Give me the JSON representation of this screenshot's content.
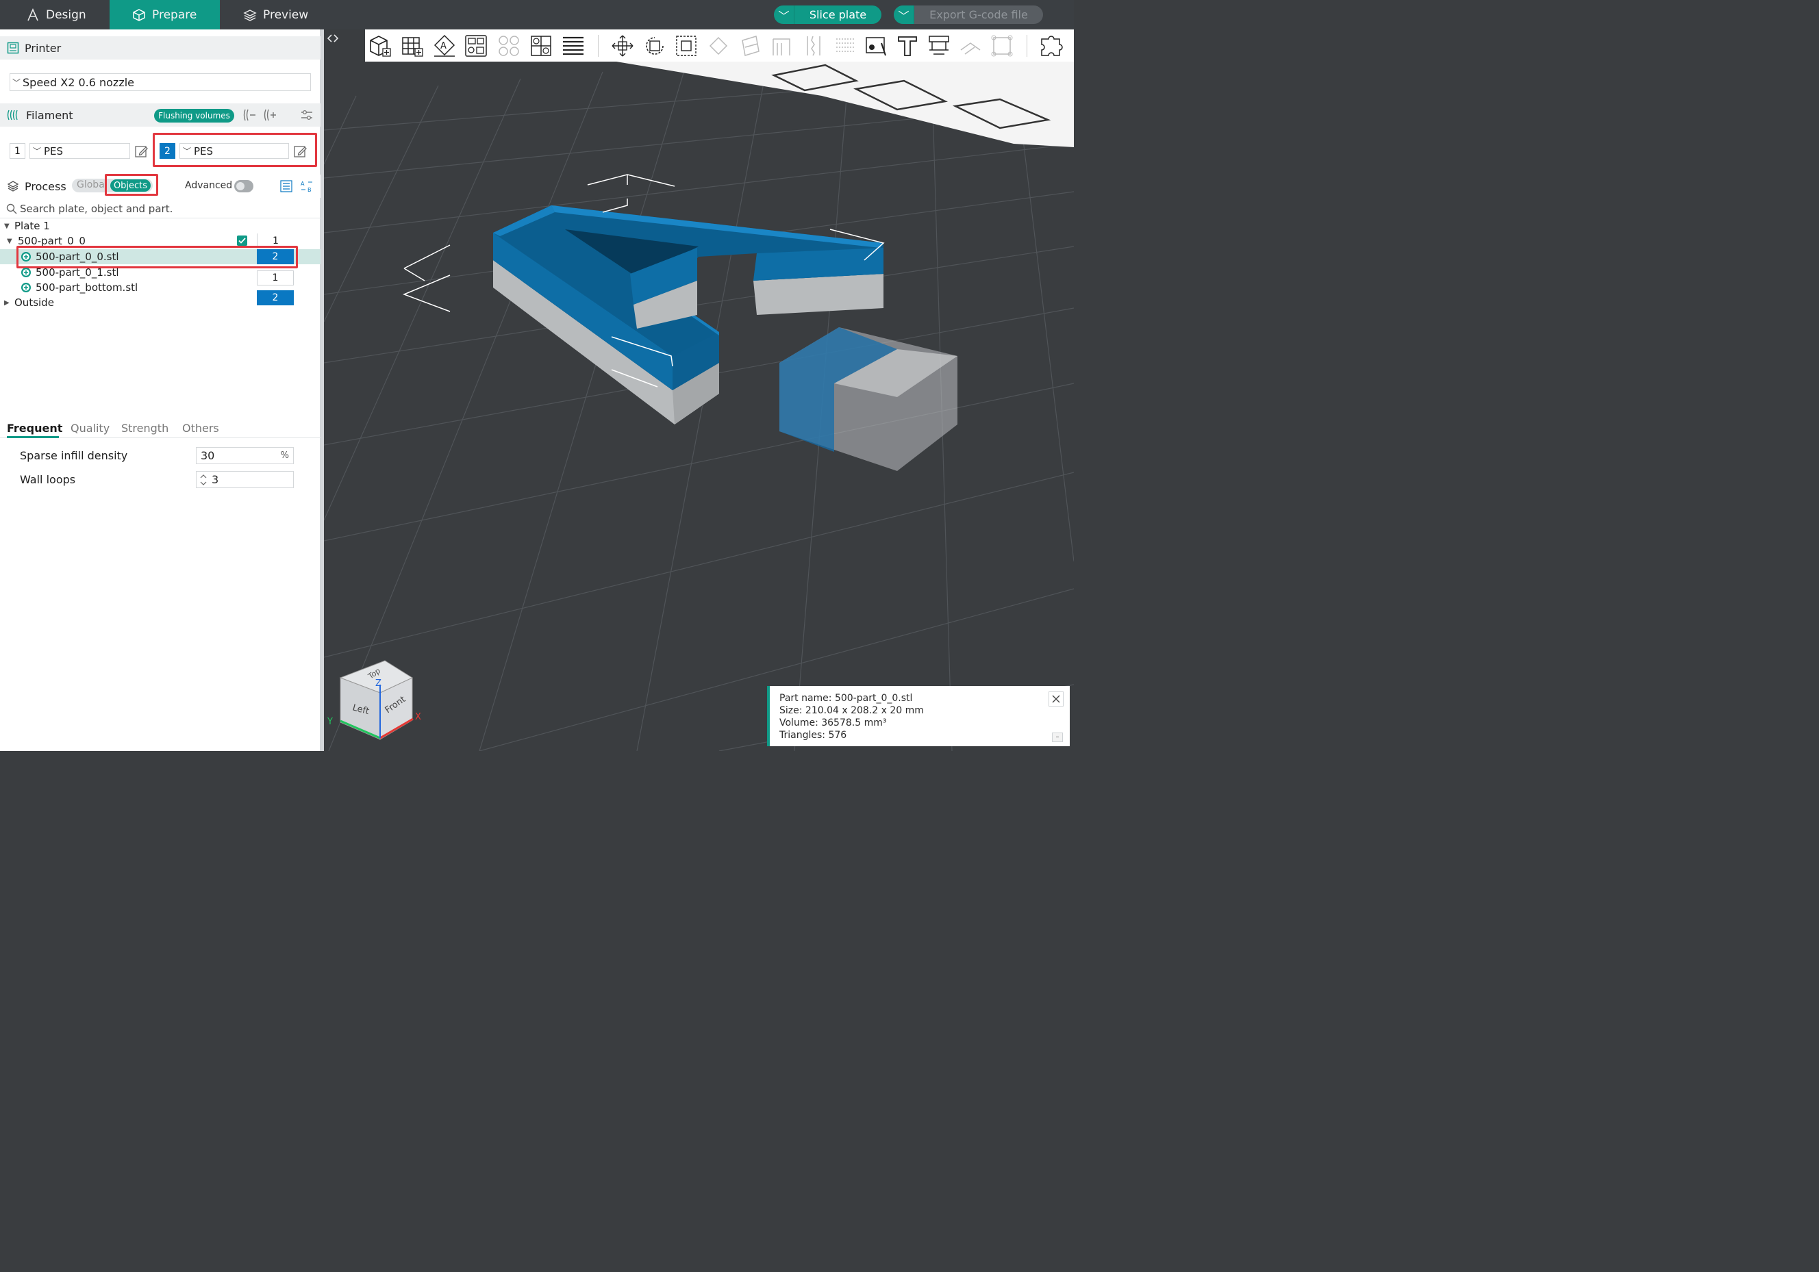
{
  "topbar": {
    "tabs": [
      {
        "label": "Design",
        "icon": "design-icon",
        "active": false
      },
      {
        "label": "Prepare",
        "icon": "cube-icon",
        "active": true
      },
      {
        "label": "Preview",
        "icon": "layers-icon",
        "active": false
      }
    ],
    "slice_label": "Slice plate",
    "export_label": "Export G-code file"
  },
  "printer": {
    "title": "Printer",
    "selected": "Speed X2 0.6 nozzle"
  },
  "filament": {
    "title": "Filament",
    "flush_label": "Flushing volumes",
    "slots": [
      {
        "num": "1",
        "name": "PES",
        "highlighted": false
      },
      {
        "num": "2",
        "name": "PES",
        "highlighted": true
      }
    ]
  },
  "process": {
    "title": "Process",
    "seg_global": "Global",
    "seg_objects": "Objects",
    "advanced_label": "Advanced",
    "search_placeholder": "Search plate, object and part."
  },
  "tree": {
    "plate": "Plate 1",
    "object": {
      "name": "500-part_0_0",
      "filament": "1"
    },
    "parts": [
      {
        "name": "500-part_0_0.stl",
        "filament": "2",
        "selected": true
      },
      {
        "name": "500-part_0_1.stl",
        "filament": "1",
        "selected": false
      },
      {
        "name": "500-part_bottom.stl",
        "filament": "2",
        "selected": false
      }
    ],
    "outside": "Outside"
  },
  "settings": {
    "tabs": [
      "Frequent",
      "Quality",
      "Strength",
      "Others"
    ],
    "active_tab": "Frequent",
    "sparse_label": "Sparse infill density",
    "sparse_value": "30",
    "sparse_unit": "%",
    "wall_label": "Wall loops",
    "wall_value": "3"
  },
  "nav_cube": {
    "top": "Top",
    "left": "Left",
    "front": "Front",
    "axis_x": "X",
    "axis_y": "Y",
    "axis_z": "Z"
  },
  "info": {
    "part_name": "Part name: 500-part_0_0.stl",
    "size": "Size: 210.04 x 208.2 x 20 mm",
    "volume": "Volume: 36578.5 mm³",
    "triangles": "Triangles: 576"
  },
  "colors": {
    "accent": "#0f9a87",
    "filament2": "#0a78c2",
    "highlight": "#e2373f",
    "bed": "#3a3d40"
  }
}
